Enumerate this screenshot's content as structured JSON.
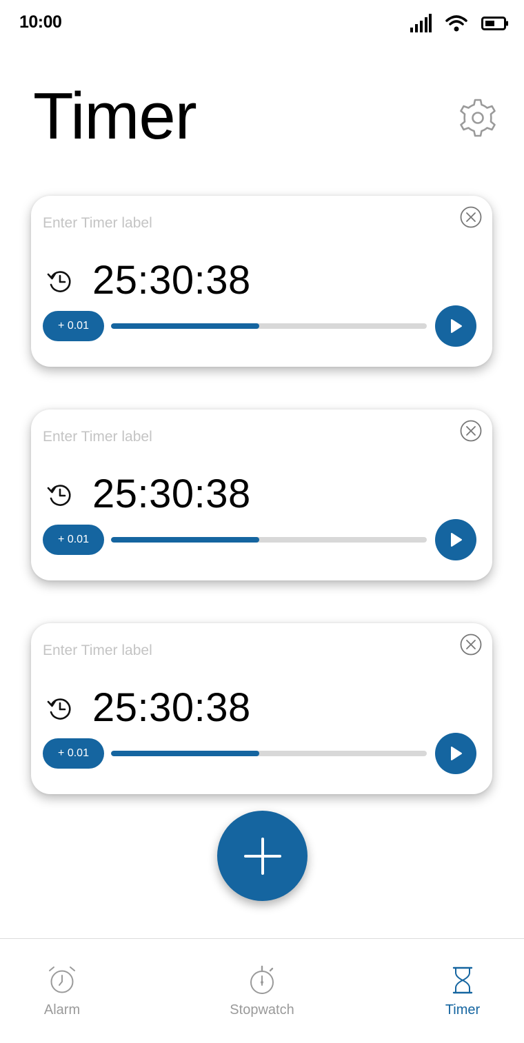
{
  "status_bar": {
    "time": "10:00"
  },
  "header": {
    "title": "Timer",
    "settings_icon": "gear-icon"
  },
  "timers": [
    {
      "label_placeholder": "Enter Timer label",
      "time": "25:30:38",
      "add_label": "+ 0.01",
      "progress": 0.47
    },
    {
      "label_placeholder": "Enter Timer label",
      "time": "25:30:38",
      "add_label": "+ 0.01",
      "progress": 0.47
    },
    {
      "label_placeholder": "Enter Timer label",
      "time": "25:30:38",
      "add_label": "+ 0.01",
      "progress": 0.47
    }
  ],
  "fab": {
    "icon": "plus-icon"
  },
  "nav": {
    "items": [
      {
        "label": "Alarm",
        "icon": "alarm-clock-icon",
        "active": false
      },
      {
        "label": "Stopwatch",
        "icon": "stopwatch-icon",
        "active": false
      },
      {
        "label": "Timer",
        "icon": "hourglass-icon",
        "active": true
      }
    ]
  },
  "colors": {
    "accent": "#1565a0",
    "inactive": "#9a9a9a",
    "placeholder": "#c4c4c4",
    "track": "#d8d8d8"
  }
}
